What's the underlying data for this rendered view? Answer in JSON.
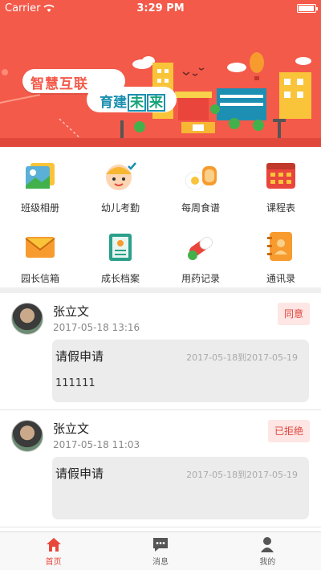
{
  "status_bar": {
    "carrier": "Carrier",
    "time": "3:29 PM",
    "battery_level": 0.95
  },
  "banner": {
    "line1": "智慧互联",
    "line2_prefix": "育建",
    "line2_box1": "未",
    "line2_box2": "来"
  },
  "grid": {
    "items": [
      {
        "label": "班级相册",
        "icon": "photo-album-icon"
      },
      {
        "label": "幼儿考勤",
        "icon": "attendance-icon"
      },
      {
        "label": "每周食谱",
        "icon": "recipe-icon"
      },
      {
        "label": "课程表",
        "icon": "timetable-icon"
      },
      {
        "label": "园长信箱",
        "icon": "mailbox-icon"
      },
      {
        "label": "成长档案",
        "icon": "growth-file-icon"
      },
      {
        "label": "用药记录",
        "icon": "medicine-icon"
      },
      {
        "label": "通讯录",
        "icon": "contacts-icon"
      }
    ]
  },
  "list": {
    "items": [
      {
        "name": "张立文",
        "time": "2017-05-18 13:16",
        "status": "同意",
        "title": "请假申请",
        "range": "2017-05-18到2017-05-19",
        "content": "111111"
      },
      {
        "name": "张立文",
        "time": "2017-05-18 11:03",
        "status": "已拒绝",
        "title": "请假申请",
        "range": "2017-05-18到2017-05-19",
        "content": ""
      }
    ]
  },
  "tabbar": {
    "items": [
      {
        "label": "首页",
        "icon": "home-icon"
      },
      {
        "label": "消息",
        "icon": "message-icon"
      },
      {
        "label": "我的",
        "icon": "profile-icon"
      }
    ],
    "active": 0
  },
  "colors": {
    "brand": "#f35a4a",
    "accent": "#e8483b"
  }
}
